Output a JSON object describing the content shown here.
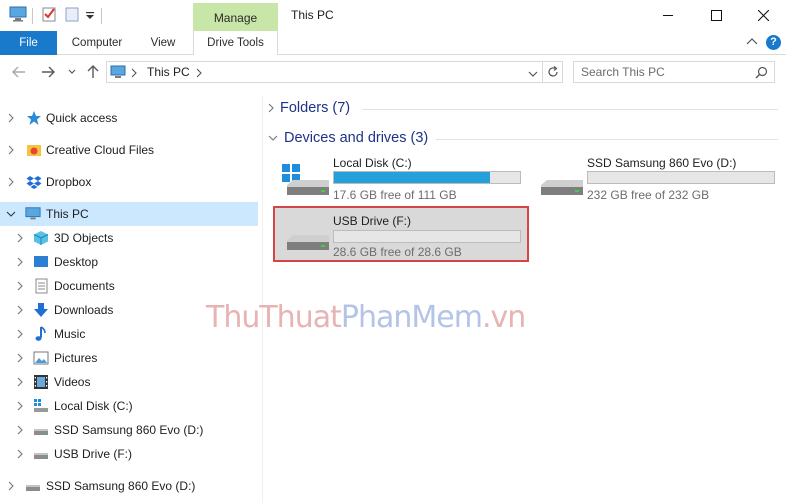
{
  "window": {
    "title": "This PC",
    "contextual_tab_group": "Manage"
  },
  "ribbon": {
    "tabs": [
      {
        "label": "File"
      },
      {
        "label": "Computer"
      },
      {
        "label": "View"
      },
      {
        "label": "Drive Tools"
      }
    ],
    "help_label": "?"
  },
  "address": {
    "path": "This PC",
    "search_placeholder": "Search This PC"
  },
  "nav": {
    "items": [
      {
        "label": "Quick access"
      },
      {
        "label": "Creative Cloud Files"
      },
      {
        "label": "Dropbox"
      },
      {
        "label": "This PC"
      },
      {
        "label": "3D Objects"
      },
      {
        "label": "Desktop"
      },
      {
        "label": "Documents"
      },
      {
        "label": "Downloads"
      },
      {
        "label": "Music"
      },
      {
        "label": "Pictures"
      },
      {
        "label": "Videos"
      },
      {
        "label": "Local Disk (C:)"
      },
      {
        "label": "SSD Samsung 860 Evo (D:)"
      },
      {
        "label": "USB Drive (F:)"
      },
      {
        "label": "SSD Samsung 860 Evo (D:)"
      }
    ]
  },
  "content": {
    "groups": [
      {
        "label": "Folders (7)"
      },
      {
        "label": "Devices and drives (3)"
      }
    ],
    "drives": [
      {
        "name": "Local Disk (C:)",
        "free_text": "17.6 GB free of 111 GB",
        "used_fraction": 0.84
      },
      {
        "name": "SSD Samsung 860 Evo (D:)",
        "free_text": "232 GB free of 232 GB",
        "used_fraction": 0.0
      },
      {
        "name": "USB Drive (F:)",
        "free_text": "28.6 GB free of 28.6 GB",
        "used_fraction": 0.0
      }
    ]
  },
  "watermark": {
    "part1": "ThuThuat",
    "part2": "PhanMem",
    "part3": ".vn"
  },
  "colors": {
    "accent": "#1979ca",
    "manage_tab": "#c8e6a8",
    "selection": "#cce8ff",
    "drive_bar": "#26a0da",
    "highlight_border": "#d64545"
  }
}
